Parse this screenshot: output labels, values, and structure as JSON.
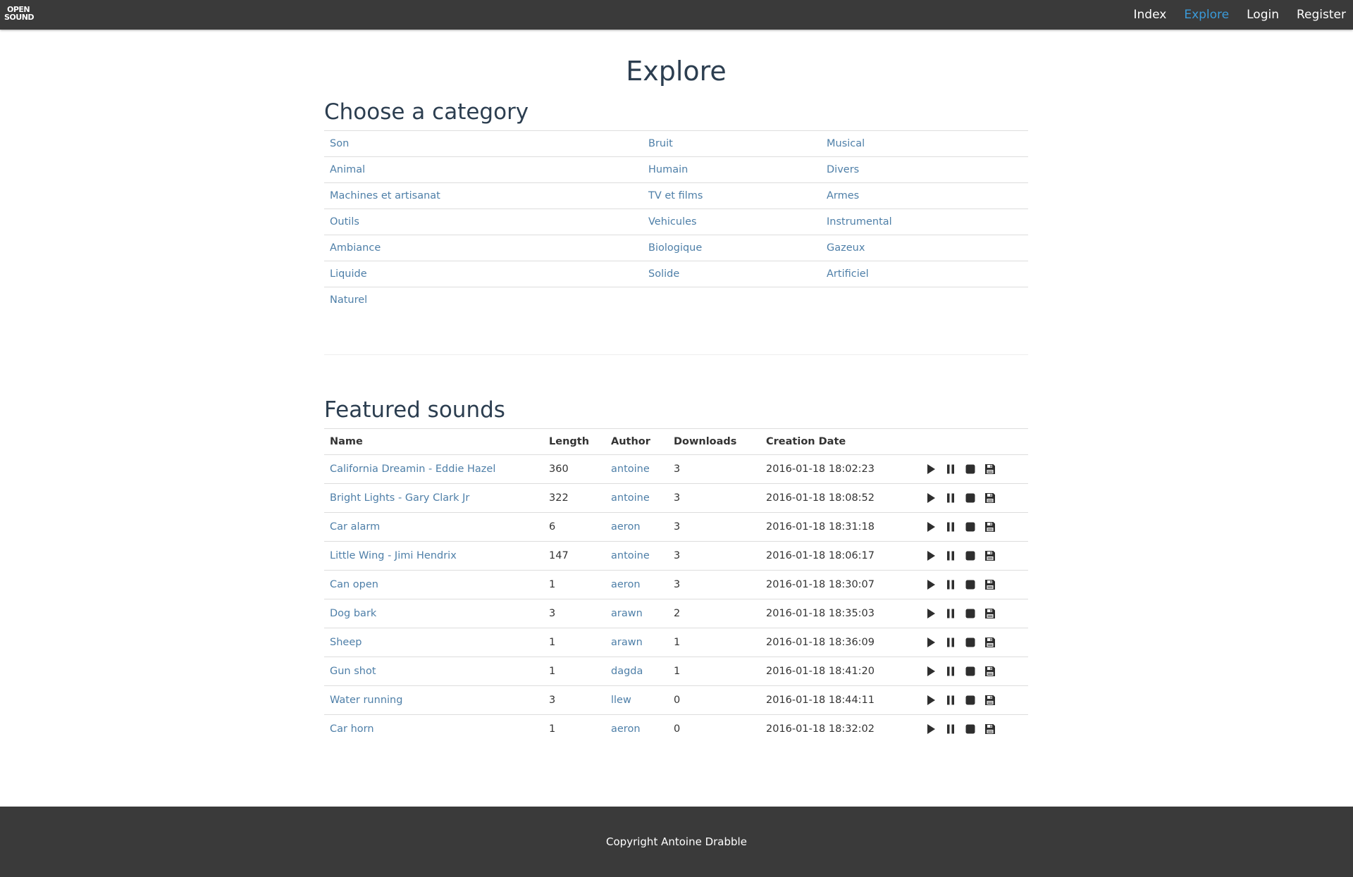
{
  "nav": {
    "logo_line1": "OPEN",
    "logo_line2": "SOUND",
    "links": [
      {
        "label": "Index"
      },
      {
        "label": "Explore"
      },
      {
        "label": "Login"
      },
      {
        "label": "Register"
      }
    ],
    "active_color": "#3a9ad9"
  },
  "page": {
    "title": "Explore"
  },
  "categories": {
    "title": "Choose a category",
    "rows": [
      [
        "Son",
        "Bruit",
        "Musical"
      ],
      [
        "Animal",
        "Humain",
        "Divers"
      ],
      [
        "Machines et artisanat",
        "TV et films",
        "Armes"
      ],
      [
        "Outils",
        "Vehicules",
        "Instrumental"
      ],
      [
        "Ambiance",
        "Biologique",
        "Gazeux"
      ],
      [
        "Liquide",
        "Solide",
        "Artificiel"
      ],
      [
        "Naturel",
        "",
        ""
      ]
    ]
  },
  "featured": {
    "title": "Featured sounds",
    "columns": [
      "Name",
      "Length",
      "Author",
      "Downloads",
      "Creation Date"
    ],
    "rows": [
      {
        "name": "California Dreamin - Eddie Hazel",
        "length": "360",
        "author": "antoine",
        "downloads": "3",
        "date": "2016-01-18 18:02:23"
      },
      {
        "name": "Bright Lights - Gary Clark Jr",
        "length": "322",
        "author": "antoine",
        "downloads": "3",
        "date": "2016-01-18 18:08:52"
      },
      {
        "name": "Car alarm",
        "length": "6",
        "author": "aeron",
        "downloads": "3",
        "date": "2016-01-18 18:31:18"
      },
      {
        "name": "Little Wing - Jimi Hendrix",
        "length": "147",
        "author": "antoine",
        "downloads": "3",
        "date": "2016-01-18 18:06:17"
      },
      {
        "name": "Can open",
        "length": "1",
        "author": "aeron",
        "downloads": "3",
        "date": "2016-01-18 18:30:07"
      },
      {
        "name": "Dog bark",
        "length": "3",
        "author": "arawn",
        "downloads": "2",
        "date": "2016-01-18 18:35:03"
      },
      {
        "name": "Sheep",
        "length": "1",
        "author": "arawn",
        "downloads": "1",
        "date": "2016-01-18 18:36:09"
      },
      {
        "name": "Gun shot",
        "length": "1",
        "author": "dagda",
        "downloads": "1",
        "date": "2016-01-18 18:41:20"
      },
      {
        "name": "Water running",
        "length": "3",
        "author": "llew",
        "downloads": "0",
        "date": "2016-01-18 18:44:11"
      },
      {
        "name": "Car horn",
        "length": "1",
        "author": "aeron",
        "downloads": "0",
        "date": "2016-01-18 18:32:02"
      }
    ],
    "controls": [
      "play-icon",
      "pause-icon",
      "stop-icon",
      "save-icon"
    ]
  },
  "footer": {
    "text": "Copyright Antoine Drabble"
  }
}
